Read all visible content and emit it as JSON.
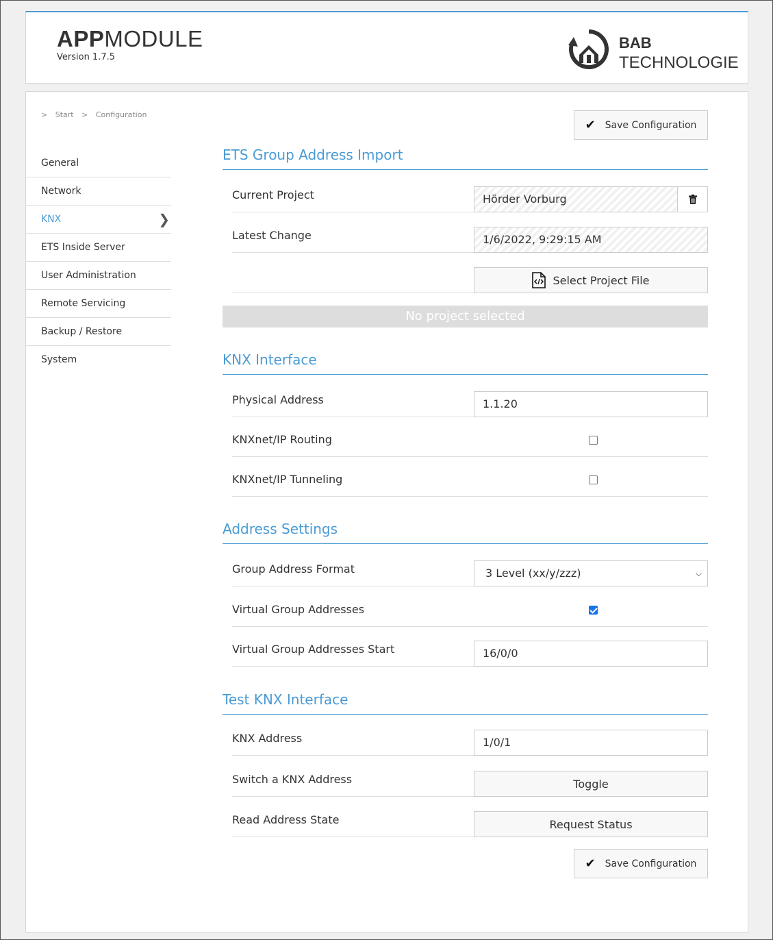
{
  "header": {
    "title_bold": "APP",
    "title_light": "MODULE",
    "version": "Version 1.7.5",
    "logo_line1": "BAB",
    "logo_line2": "TECHNOLOGIE"
  },
  "breadcrumb": [
    ">",
    "Start",
    ">",
    "Configuration"
  ],
  "sidebar": {
    "active": "KNX",
    "items": [
      {
        "label": "General"
      },
      {
        "label": "Network"
      },
      {
        "label": "KNX"
      },
      {
        "label": "ETS Inside Server"
      },
      {
        "label": "User Administration"
      },
      {
        "label": "Remote Servicing"
      },
      {
        "label": "Backup / Restore"
      },
      {
        "label": "System"
      }
    ]
  },
  "save_label": "Save Configuration",
  "ets_import": {
    "title": "ETS Group Address Import",
    "current_project_label": "Current Project",
    "current_project_value": "Hörder Vorburg",
    "latest_change_label": "Latest Change",
    "latest_change_value": "1/6/2022, 9:29:15 AM",
    "select_file_label": "Select Project File",
    "status": "No project selected"
  },
  "knx_interface": {
    "title": "KNX Interface",
    "physical_address_label": "Physical Address",
    "physical_address_value": "1.1.20",
    "routing_label": "KNXnet/IP Routing",
    "routing_checked": false,
    "tunneling_label": "KNXnet/IP Tunneling",
    "tunneling_checked": false
  },
  "address_settings": {
    "title": "Address Settings",
    "format_label": "Group Address Format",
    "format_value": "3 Level (xx/y/zzz)",
    "virtual_label": "Virtual Group Addresses",
    "virtual_checked": true,
    "virtual_start_label": "Virtual Group Addresses Start",
    "virtual_start_value": "16/0/0"
  },
  "test_knx": {
    "title": "Test KNX Interface",
    "address_label": "KNX Address",
    "address_value": "1/0/1",
    "switch_label": "Switch a KNX Address",
    "toggle_label": "Toggle",
    "read_label": "Read Address State",
    "request_label": "Request Status"
  },
  "colors": {
    "accent": "#4a9bd4",
    "checkbox": "#1a73e8"
  }
}
